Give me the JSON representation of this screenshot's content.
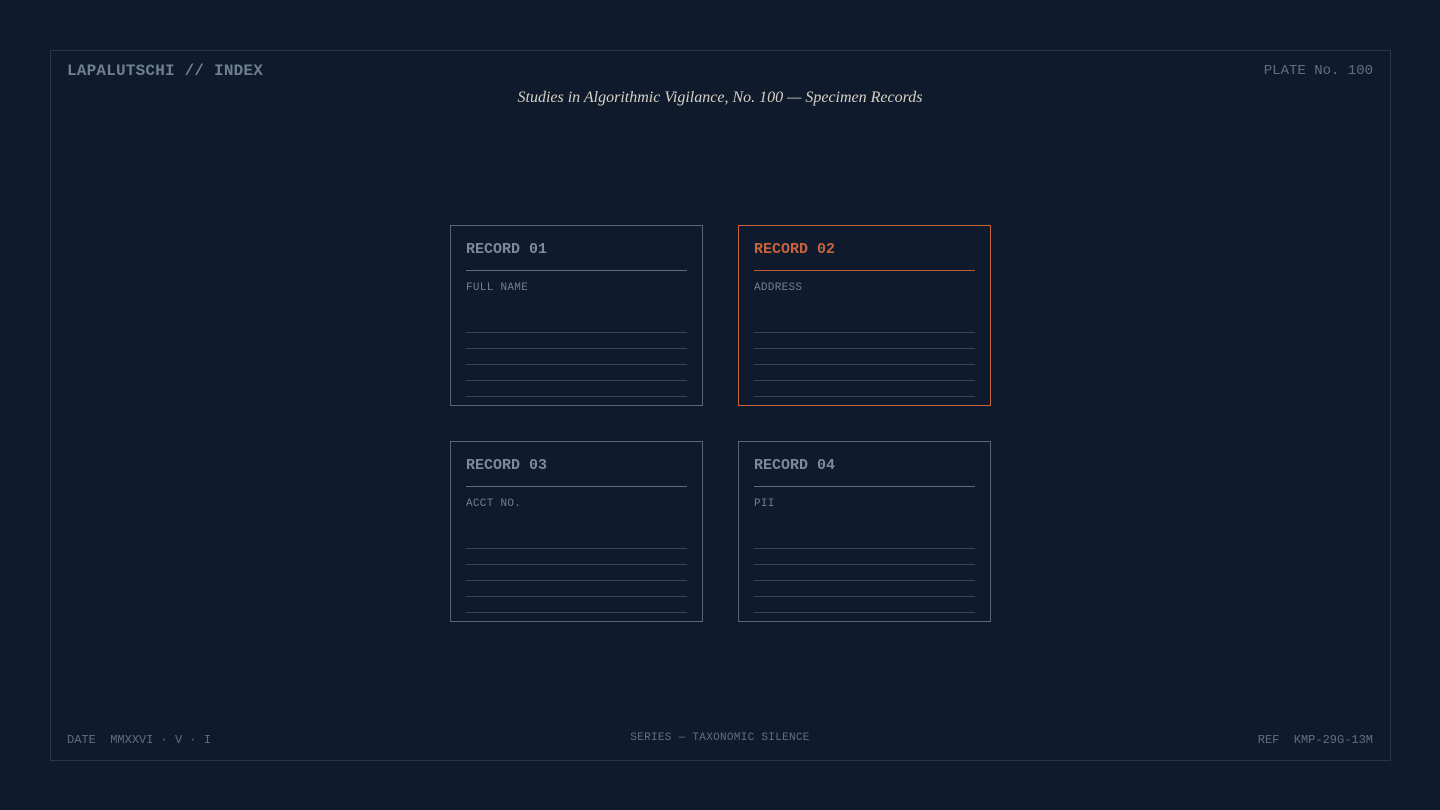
{
  "header": {
    "brand": "LAPALUTSCHI // INDEX",
    "plate": "PLATE No. 100",
    "title": "Studies in Algorithmic Vigilance, No. 100 — Specimen Records"
  },
  "records": [
    {
      "title": "RECORD 01",
      "label": "FULL NAME",
      "highlighted": false
    },
    {
      "title": "RECORD 02",
      "label": "ADDRESS",
      "highlighted": true
    },
    {
      "title": "RECORD 03",
      "label": "ACCT NO.",
      "highlighted": false
    },
    {
      "title": "RECORD 04",
      "label": "PII",
      "highlighted": false
    }
  ],
  "footer": {
    "date_label": "DATE",
    "date_value": "MMXXVI · V · I",
    "series": "SERIES — TAXONOMIC SILENCE",
    "ref_label": "REF",
    "ref_value": "KMP-29G-13M"
  },
  "colors": {
    "background": "#0f1b2d",
    "accent": "#c8643c",
    "muted": "#6e7f93",
    "title_text": "#d6d1c4"
  }
}
